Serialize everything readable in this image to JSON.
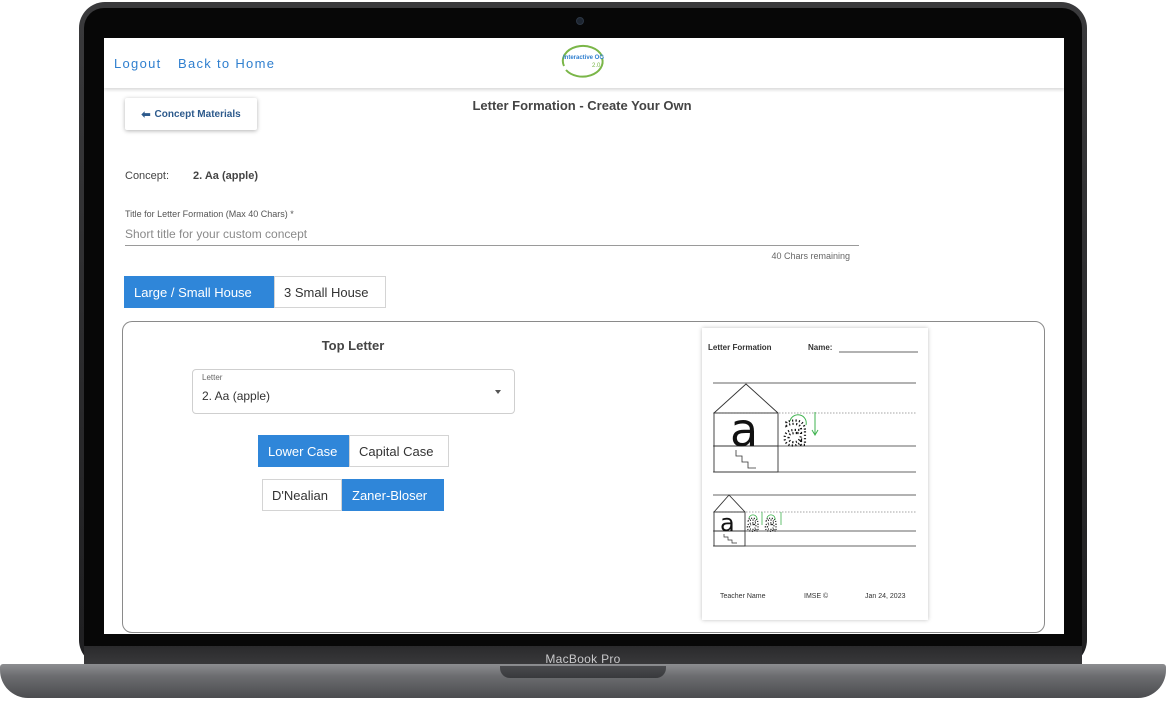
{
  "device": {
    "label": "MacBook Pro"
  },
  "header": {
    "logout": "Logout",
    "back_home": "Back to Home",
    "logo_text": "Interactive OG",
    "logo_sub": "2.0"
  },
  "page": {
    "back_button": "Concept Materials",
    "title": "Letter Formation - Create Your Own",
    "concept_label": "Concept:",
    "concept_value": "2. Aa (apple)",
    "title_field_label": "Title for Letter Formation (Max 40 Chars) *",
    "title_field_placeholder": "Short title for your custom concept",
    "title_field_value": "",
    "chars_remaining": "40 Chars remaining"
  },
  "house_options": {
    "items": [
      "Large / Small House",
      "3 Small House"
    ],
    "selected": "Large / Small House"
  },
  "top_letter": {
    "heading": "Top Letter",
    "letter_label": "Letter",
    "letter_value": "2. Aa (apple)",
    "case_options": [
      "Lower Case",
      "Capital Case"
    ],
    "case_selected": "Lower Case",
    "style_options": [
      "D'Nealian",
      "Zaner-Bloser"
    ],
    "style_selected": "Zaner-Bloser"
  },
  "preview": {
    "title": "Letter Formation",
    "name_label": "Name:",
    "letter": "a",
    "teacher": "Teacher Name",
    "brand": "IMSE ©",
    "date": "Jan 24, 2023"
  },
  "colors": {
    "accent": "#2f86d9",
    "link": "#2f7fcf",
    "trace_green": "#3fb34f"
  }
}
